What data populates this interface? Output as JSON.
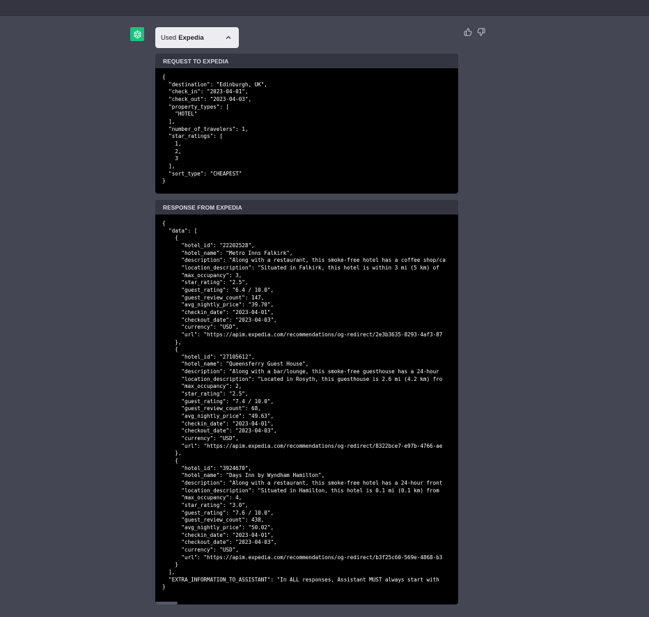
{
  "plugin": {
    "used_label": "Used",
    "name": "Expedia"
  },
  "request": {
    "header": "REQUEST TO EXPEDIA",
    "code": "{\n  \"destination\": \"Edinburgh, UK\",\n  \"check_in\": \"2023-04-01\",\n  \"check_out\": \"2023-04-03\",\n  \"property_types\": [\n    \"HOTEL\"\n  ],\n  \"number_of_travelers\": 1,\n  \"star_ratings\": [\n    1,\n    2,\n    3\n  ],\n  \"sort_type\": \"CHEAPEST\"\n}"
  },
  "response": {
    "header": "RESPONSE FROM EXPEDIA",
    "code": "{\n  \"data\": [\n    {\n      \"hotel_id\": \"22202528\",\n      \"hotel_name\": \"Metro Inns Falkirk\",\n      \"description\": \"Along with a restaurant, this smoke-free hotel has a coffee shop/ca\n      \"location_description\": \"Situated in Falkirk, this hotel is within 3 mi (5 km) of \n      \"max_occupancy\": 3,\n      \"star_rating\": \"2.5\",\n      \"guest_rating\": \"6.4 / 10.0\",\n      \"guest_review_count\": 147,\n      \"avg_nightly_price\": \"39.70\",\n      \"checkin_date\": \"2023-04-01\",\n      \"checkout_date\": \"2023-04-03\",\n      \"currency\": \"USD\",\n      \"url\": \"https://apim.expedia.com/recommendations/og-redirect/2e3b3635-8293-4af3-87\n    },\n    {\n      \"hotel_id\": \"27105612\",\n      \"hotel_name\": \"Queensferry Guest House\",\n      \"description\": \"Along with a bar/lounge, this smoke-free guesthouse has a 24-hour \n      \"location_description\": \"Located in Rosyth, this guesthouse is 2.6 mi (4.2 km) fro\n      \"max_occupancy\": 2,\n      \"star_rating\": \"2.5\",\n      \"guest_rating\": \"7.4 / 10.0\",\n      \"guest_review_count\": 68,\n      \"avg_nightly_price\": \"49.63\",\n      \"checkin_date\": \"2023-04-01\",\n      \"checkout_date\": \"2023-04-03\",\n      \"currency\": \"USD\",\n      \"url\": \"https://apim.expedia.com/recommendations/og-redirect/8322bce7-e97b-4766-ae\n    },\n    {\n      \"hotel_id\": \"3924670\",\n      \"hotel_name\": \"Days Inn by Wyndham Hamilton\",\n      \"description\": \"Along with a restaurant, this smoke-free hotel has a 24-hour front\n      \"location_description\": \"Situated in Hamilton, this hotel is 0.1 mi (0.1 km) from \n      \"max_occupancy\": 4,\n      \"star_rating\": \"3.0\",\n      \"guest_rating\": \"7.6 / 10.0\",\n      \"guest_review_count\": 438,\n      \"avg_nightly_price\": \"50.02\",\n      \"checkin_date\": \"2023-04-01\",\n      \"checkout_date\": \"2023-04-03\",\n      \"currency\": \"USD\",\n      \"url\": \"https://apim.expedia.com/recommendations/og-redirect/b3f25c60-569e-4868-b3\n    }\n  ],\n  \"EXTRA_INFORMATION_TO_ASSISTANT\": \"In ALL responses, Assistant MUST always start with \n}"
  },
  "icons": {
    "assistant": "openai-logo-icon",
    "chevron": "chevron-up-icon",
    "thumbs_up": "thumbs-up-icon",
    "thumbs_down": "thumbs-down-icon"
  },
  "colors": {
    "background": "#444654",
    "code_background": "#000000",
    "header_background": "#343541",
    "avatar": "#19c37d"
  }
}
